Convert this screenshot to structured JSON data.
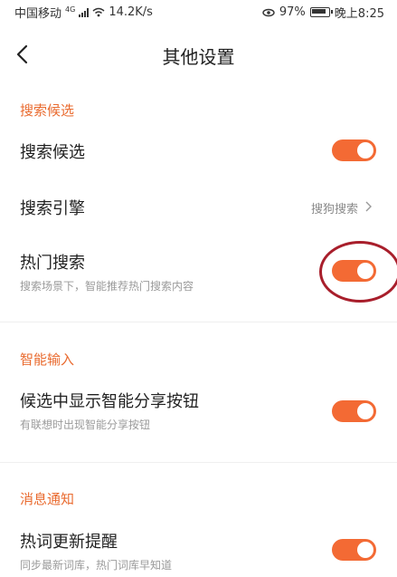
{
  "status_bar": {
    "carrier": "中国移动",
    "network": "4G",
    "speed": "14.2K/s",
    "battery": "97%",
    "time": "晚上8:25"
  },
  "header": {
    "title": "其他设置"
  },
  "sections": {
    "search": {
      "title": "搜索候选",
      "candidates": {
        "label": "搜索候选",
        "enabled": true
      },
      "engine": {
        "label": "搜索引擎",
        "value": "搜狗搜索"
      },
      "hot": {
        "label": "热门搜索",
        "sub": "搜索场景下，智能推荐热门搜索内容",
        "enabled": true
      }
    },
    "smart": {
      "title": "智能输入",
      "share": {
        "label": "候选中显示智能分享按钮",
        "sub": "有联想时出现智能分享按钮",
        "enabled": true
      }
    },
    "notify": {
      "title": "消息通知",
      "hotword": {
        "label": "热词更新提醒",
        "sub": "同步最新词库，热门词库早知道",
        "enabled": true
      }
    }
  },
  "colors": {
    "accent": "#f36a34",
    "annotation": "#a81e2b"
  }
}
